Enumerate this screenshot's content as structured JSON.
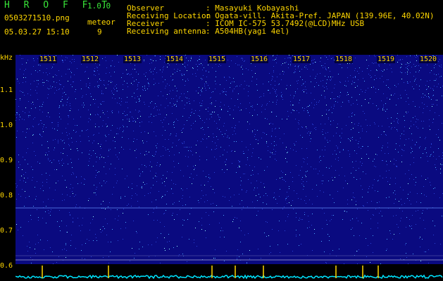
{
  "app": {
    "logo": "H R O F F T",
    "version": "1.0.0"
  },
  "file": {
    "name": "0503271510.png",
    "datetime": "05.03.27 15:10"
  },
  "counter": {
    "label": "meteor",
    "value": "9"
  },
  "info": {
    "observer_label": "Observer",
    "observer_value": ": Masayuki Kobayashi",
    "location_label": "Receiving Location",
    "location_value": ": Ogata-vill. Akita-Pref. JAPAN (139.96E, 40.02N)",
    "receiver_label": "Receiver",
    "receiver_value": ": ICOM IC-575 53.7492(@LCD)MHz USB",
    "antenna_label": "Receiving antenna",
    "antenna_value": ": A504HB(yagi 4el)"
  },
  "axes": {
    "y_unit": "kHz",
    "y_ticks": [
      "1.1",
      "1.0",
      "0.9",
      "0.8",
      "0.7",
      "0.6"
    ],
    "x_ticks": [
      "1511",
      "1512",
      "1513",
      "1514",
      "1515",
      "1516",
      "1517",
      "1518",
      "1519",
      "1520"
    ]
  },
  "colors": {
    "label": "#ffd700",
    "logo": "#39e639",
    "spectrum_bg": "#0a0a80",
    "trace": "#00e5ff"
  }
}
